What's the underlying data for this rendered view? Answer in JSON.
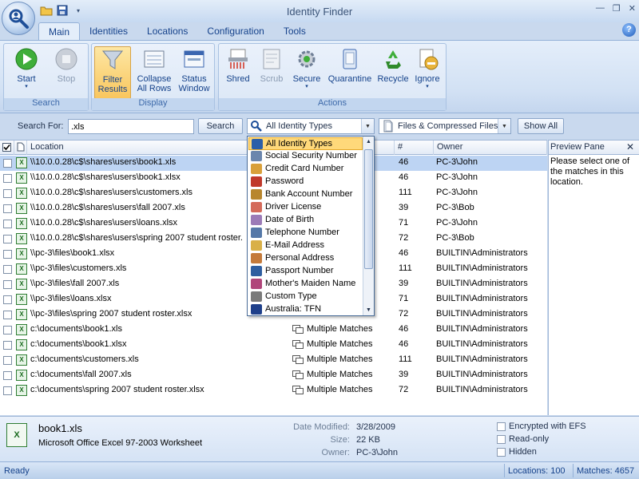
{
  "window": {
    "title": "Identity Finder"
  },
  "tabs": [
    {
      "label": "Main",
      "active": true
    },
    {
      "label": "Identities"
    },
    {
      "label": "Locations"
    },
    {
      "label": "Configuration"
    },
    {
      "label": "Tools"
    }
  ],
  "ribbon": {
    "search_group": "Search",
    "display_group": "Display",
    "actions_group": "Actions",
    "start": "Start",
    "stop": "Stop",
    "filter_results": [
      "Filter",
      "Results"
    ],
    "collapse_all_rows": [
      "Collapse",
      "All Rows"
    ],
    "status_window": [
      "Status",
      "Window"
    ],
    "shred": "Shred",
    "scrub": "Scrub",
    "secure": "Secure",
    "quarantine": "Quarantine",
    "recycle": "Recycle",
    "ignore": "Ignore"
  },
  "search": {
    "label": "Search For:",
    "value": ".xls",
    "button": "Search",
    "identity_type": "All Identity Types",
    "file_type": "Files & Compressed Files",
    "show_all": "Show All"
  },
  "grid": {
    "columns": {
      "location": "Location",
      "count": "#",
      "owner": "Owner"
    },
    "rows": [
      {
        "location": "\\\\10.0.0.28\\c$\\shares\\users\\book1.xls",
        "match": "",
        "count": "46",
        "owner": "PC-3\\John",
        "selected": true
      },
      {
        "location": "\\\\10.0.0.28\\c$\\shares\\users\\book1.xlsx",
        "match": "",
        "count": "46",
        "owner": "PC-3\\John"
      },
      {
        "location": "\\\\10.0.0.28\\c$\\shares\\users\\customers.xls",
        "match": "",
        "count": "111",
        "owner": "PC-3\\John"
      },
      {
        "location": "\\\\10.0.0.28\\c$\\shares\\users\\fall 2007.xls",
        "match": "",
        "count": "39",
        "owner": "PC-3\\Bob"
      },
      {
        "location": "\\\\10.0.0.28\\c$\\shares\\users\\loans.xlsx",
        "match": "",
        "count": "71",
        "owner": "PC-3\\John"
      },
      {
        "location": "\\\\10.0.0.28\\c$\\shares\\users\\spring 2007 student roster.",
        "match": "",
        "count": "72",
        "owner": "PC-3\\Bob"
      },
      {
        "location": "\\\\pc-3\\files\\book1.xlsx",
        "match": "",
        "count": "46",
        "owner": "BUILTIN\\Administrators"
      },
      {
        "location": "\\\\pc-3\\files\\customers.xls",
        "match": "",
        "count": "111",
        "owner": "BUILTIN\\Administrators"
      },
      {
        "location": "\\\\pc-3\\files\\fall 2007.xls",
        "match": "",
        "count": "39",
        "owner": "BUILTIN\\Administrators"
      },
      {
        "location": "\\\\pc-3\\files\\loans.xlsx",
        "match": "",
        "count": "71",
        "owner": "BUILTIN\\Administrators"
      },
      {
        "location": "\\\\pc-3\\files\\spring 2007 student roster.xlsx",
        "match": "",
        "count": "72",
        "owner": "BUILTIN\\Administrators"
      },
      {
        "location": "c:\\documents\\book1.xls",
        "match": "Multiple Matches",
        "count": "46",
        "owner": "BUILTIN\\Administrators"
      },
      {
        "location": "c:\\documents\\book1.xlsx",
        "match": "Multiple Matches",
        "count": "46",
        "owner": "BUILTIN\\Administrators"
      },
      {
        "location": "c:\\documents\\customers.xls",
        "match": "Multiple Matches",
        "count": "111",
        "owner": "BUILTIN\\Administrators"
      },
      {
        "location": "c:\\documents\\fall 2007.xls",
        "match": "Multiple Matches",
        "count": "39",
        "owner": "BUILTIN\\Administrators"
      },
      {
        "location": "c:\\documents\\spring 2007 student roster.xlsx",
        "match": "Multiple Matches",
        "count": "72",
        "owner": "BUILTIN\\Administrators"
      }
    ]
  },
  "preview": {
    "title": "Preview Pane",
    "text": "Please select one of the matches in this location."
  },
  "dropdown": {
    "items": [
      {
        "label": "All Identity Types",
        "icon": "magnifier-icon",
        "color": "#2b5fa8",
        "highlight": true
      },
      {
        "label": "Social Security Number",
        "icon": "ssn-card-icon",
        "color": "#6b86ad"
      },
      {
        "label": "Credit Card Number",
        "icon": "credit-card-icon",
        "color": "#d9a03a"
      },
      {
        "label": "Password",
        "icon": "password-icon",
        "color": "#c0392b"
      },
      {
        "label": "Bank Account Number",
        "icon": "bank-icon",
        "color": "#b8862d"
      },
      {
        "label": "Driver License",
        "icon": "driver-license-icon",
        "color": "#d46a5a"
      },
      {
        "label": "Date of Birth",
        "icon": "calendar-icon",
        "color": "#9c7bb7"
      },
      {
        "label": "Telephone Number",
        "icon": "telephone-icon",
        "color": "#5578a8"
      },
      {
        "label": "E-Mail Address",
        "icon": "email-icon",
        "color": "#d9b048"
      },
      {
        "label": "Personal Address",
        "icon": "address-icon",
        "color": "#c47a3a"
      },
      {
        "label": "Passport Number",
        "icon": "passport-icon",
        "color": "#2e5ea0"
      },
      {
        "label": "Mother's Maiden Name",
        "icon": "maiden-name-icon",
        "color": "#b0457a"
      },
      {
        "label": "Custom Type",
        "icon": "custom-type-icon",
        "color": "#7a7a7a"
      },
      {
        "label": "Australia: TFN",
        "icon": "australia-flag-icon",
        "color": "#1e3f8a"
      }
    ]
  },
  "details": {
    "file_name": "book1.xls",
    "file_type": "Microsoft Office Excel 97-2003 Worksheet",
    "date_modified_label": "Date Modified:",
    "date_modified": "3/28/2009",
    "size_label": "Size:",
    "size": "22 KB",
    "owner_label": "Owner:",
    "owner": "PC-3\\John",
    "encrypted": "Encrypted with EFS",
    "readonly": "Read-only",
    "hidden": "Hidden"
  },
  "status": {
    "text": "Ready",
    "locations": "Locations: 100",
    "matches": "Matches: 4657"
  }
}
